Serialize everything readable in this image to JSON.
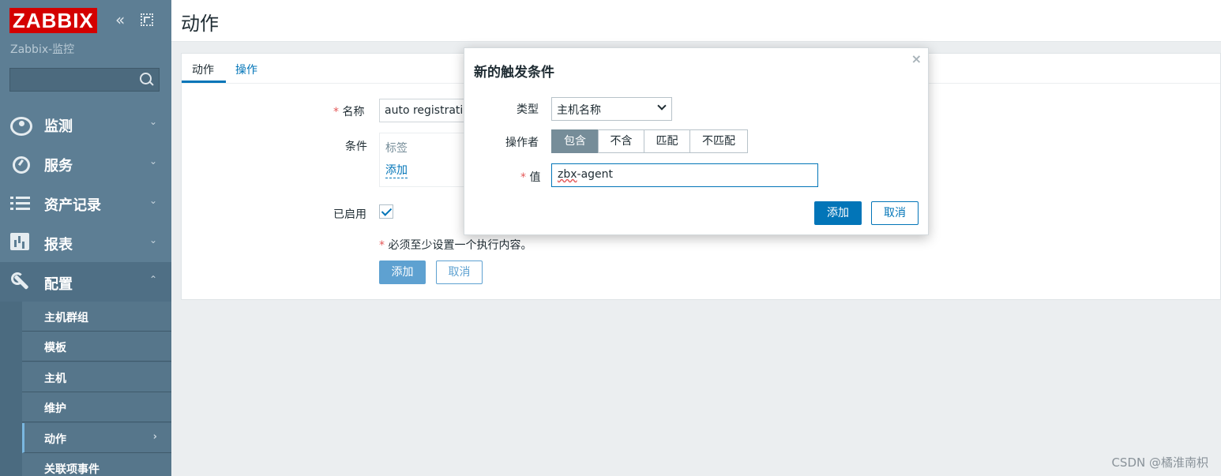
{
  "sidebar": {
    "logo": "ZABBIX",
    "server_name": "Zabbix-监控",
    "search_placeholder": "",
    "menu": [
      {
        "label": "监测",
        "icon": "eye-icon",
        "arrow": "⌄"
      },
      {
        "label": "服务",
        "icon": "stopwatch-icon",
        "arrow": "⌄"
      },
      {
        "label": "资产记录",
        "icon": "list-icon",
        "arrow": "⌄"
      },
      {
        "label": "报表",
        "icon": "bar-chart-icon",
        "arrow": "⌄"
      },
      {
        "label": "配置",
        "icon": "wrench-icon",
        "arrow": "⌃"
      }
    ],
    "submenu": [
      {
        "label": "主机群组"
      },
      {
        "label": "模板"
      },
      {
        "label": "主机"
      },
      {
        "label": "维护"
      },
      {
        "label": "动作",
        "arrow": "›"
      },
      {
        "label": "关联项事件"
      }
    ]
  },
  "page": {
    "title": "动作"
  },
  "tabs": [
    {
      "label": "动作"
    },
    {
      "label": "操作"
    }
  ],
  "form": {
    "name_label": "名称",
    "name_value": "auto registratio",
    "conditions_label": "条件",
    "conditions_header": "标签",
    "conditions_add_link": "添加",
    "enabled_label": "已启用",
    "enabled_checked": true,
    "required_note": "必须至少设置一个执行内容。",
    "required_mark": "*",
    "add_button": "添加",
    "cancel_button": "取消"
  },
  "dialog": {
    "title": "新的触发条件",
    "close_glyph": "×",
    "type_label": "类型",
    "type_value": "主机名称",
    "operator_label": "操作者",
    "operators": [
      "包含",
      "不含",
      "匹配",
      "不匹配"
    ],
    "operator_selected": "包含",
    "value_label": "值",
    "value_input_prefix": "zbx",
    "value_input_suffix": "-agent",
    "add_button": "添加",
    "cancel_button": "取消"
  },
  "watermark": "CSDN @橘淮南枳",
  "colors": {
    "sidebar": "#5d7e94",
    "primary": "#0275b8",
    "logo_red": "#d40000",
    "required": "#e45959"
  }
}
